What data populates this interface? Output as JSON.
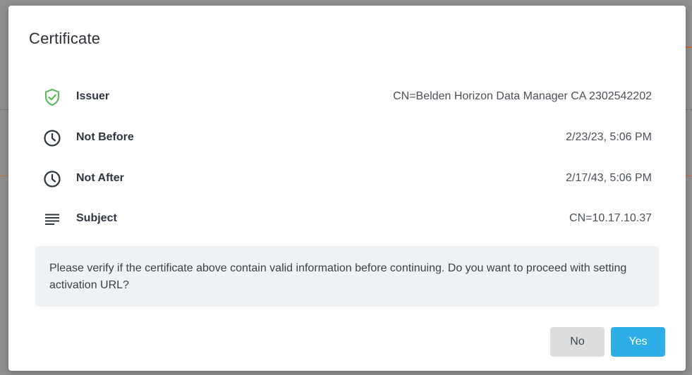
{
  "dialog": {
    "title": "Certificate",
    "rows": [
      {
        "icon": "shield-check-icon",
        "label": "Issuer",
        "value": "CN=Belden Horizon Data Manager CA 2302542202"
      },
      {
        "icon": "clock-icon",
        "label": "Not Before",
        "value": "2/23/23, 5:06 PM"
      },
      {
        "icon": "clock-icon",
        "label": "Not After",
        "value": "2/17/43, 5:06 PM"
      },
      {
        "icon": "lines-icon",
        "label": "Subject",
        "value": "CN=10.17.10.37"
      }
    ],
    "notice": "Please verify if the certificate above contain valid information before continuing. Do you want to proceed with setting activation URL?",
    "buttons": {
      "no_label": "No",
      "yes_label": "Yes"
    }
  },
  "colors": {
    "shield": "#5cb85c",
    "icon_dark": "#2c3540",
    "primary": "#2daee6",
    "secondary": "#dcdddf",
    "accent_line": "#e0651f"
  }
}
